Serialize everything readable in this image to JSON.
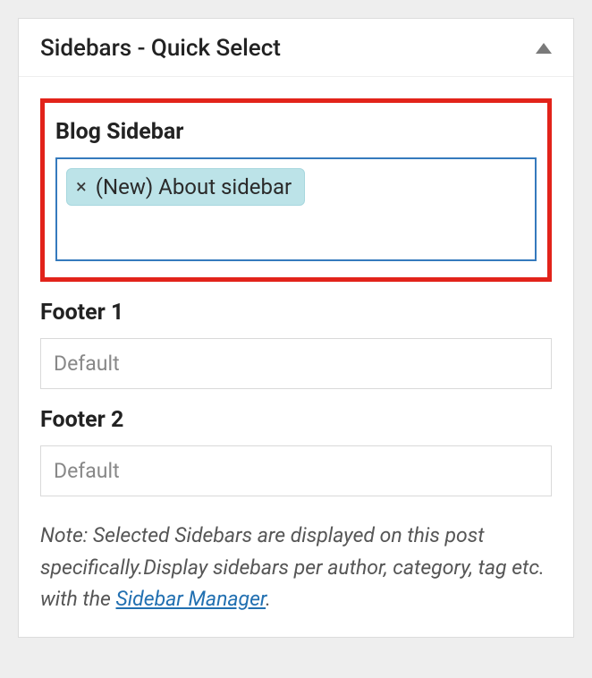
{
  "metabox": {
    "title": "Sidebars - Quick Select"
  },
  "blog_sidebar": {
    "label": "Blog Sidebar",
    "tag_remove_symbol": "×",
    "tag_text": "(New) About sidebar"
  },
  "footer1": {
    "label": "Footer 1",
    "placeholder": "Default"
  },
  "footer2": {
    "label": "Footer 2",
    "placeholder": "Default"
  },
  "note": {
    "text_before": "Note: Selected Sidebars are displayed on this post specifically.Display sidebars per author, category, tag etc. with the ",
    "link_text": "Sidebar Manager",
    "text_after": "."
  }
}
